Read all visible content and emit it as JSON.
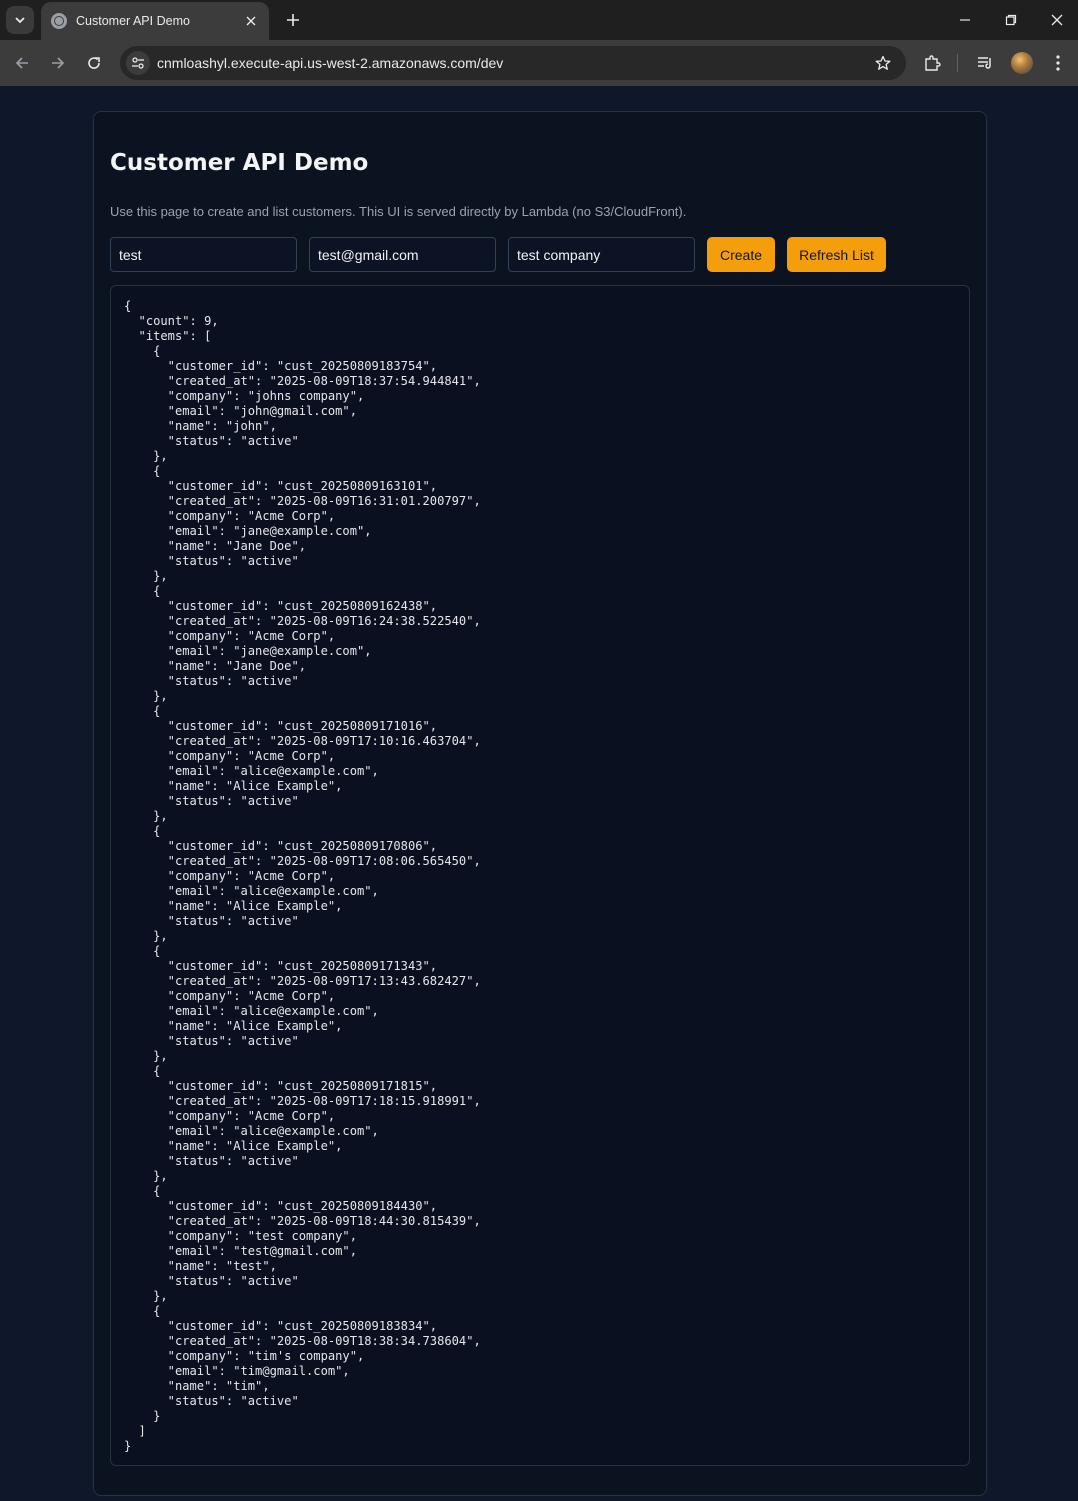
{
  "browser": {
    "tab_title": "Customer API Demo",
    "url": "cnmloashyl.execute-api.us-west-2.amazonaws.com/dev",
    "icons": [
      "tab-search-icon",
      "globe-icon",
      "close-icon",
      "plus-icon",
      "minimize-icon",
      "restore-icon",
      "close-window-icon",
      "back-icon",
      "forward-icon",
      "reload-icon",
      "site-info-icon",
      "star-icon",
      "extensions-icon",
      "media-icon",
      "more-icon"
    ]
  },
  "page": {
    "title": "Customer API Demo",
    "subtitle": "Use this page to create and list customers. This UI is served directly by Lambda (no S3/CloudFront).",
    "form": {
      "name_value": "test",
      "email_value": "test@gmail.com",
      "company_value": "test company",
      "create_label": "Create",
      "refresh_label": "Refresh List"
    },
    "output": {
      "count": 9,
      "items": [
        {
          "customer_id": "cust_20250809183754",
          "created_at": "2025-08-09T18:37:54.944841",
          "company": "johns company",
          "email": "john@gmail.com",
          "name": "john",
          "status": "active"
        },
        {
          "customer_id": "cust_20250809163101",
          "created_at": "2025-08-09T16:31:01.200797",
          "company": "Acme Corp",
          "email": "jane@example.com",
          "name": "Jane Doe",
          "status": "active"
        },
        {
          "customer_id": "cust_20250809162438",
          "created_at": "2025-08-09T16:24:38.522540",
          "company": "Acme Corp",
          "email": "jane@example.com",
          "name": "Jane Doe",
          "status": "active"
        },
        {
          "customer_id": "cust_20250809171016",
          "created_at": "2025-08-09T17:10:16.463704",
          "company": "Acme Corp",
          "email": "alice@example.com",
          "name": "Alice Example",
          "status": "active"
        },
        {
          "customer_id": "cust_20250809170806",
          "created_at": "2025-08-09T17:08:06.565450",
          "company": "Acme Corp",
          "email": "alice@example.com",
          "name": "Alice Example",
          "status": "active"
        },
        {
          "customer_id": "cust_20250809171343",
          "created_at": "2025-08-09T17:13:43.682427",
          "company": "Acme Corp",
          "email": "alice@example.com",
          "name": "Alice Example",
          "status": "active"
        },
        {
          "customer_id": "cust_20250809171815",
          "created_at": "2025-08-09T17:18:15.918991",
          "company": "Acme Corp",
          "email": "alice@example.com",
          "name": "Alice Example",
          "status": "active"
        },
        {
          "customer_id": "cust_20250809184430",
          "created_at": "2025-08-09T18:44:30.815439",
          "company": "test company",
          "email": "test@gmail.com",
          "name": "test",
          "status": "active"
        },
        {
          "customer_id": "cust_20250809183834",
          "created_at": "2025-08-09T18:38:34.738604",
          "company": "tim's company",
          "email": "tim@gmail.com",
          "name": "tim",
          "status": "active"
        }
      ]
    }
  },
  "colors": {
    "page_bg": "#0f172a",
    "accent": "#f59e0b"
  }
}
